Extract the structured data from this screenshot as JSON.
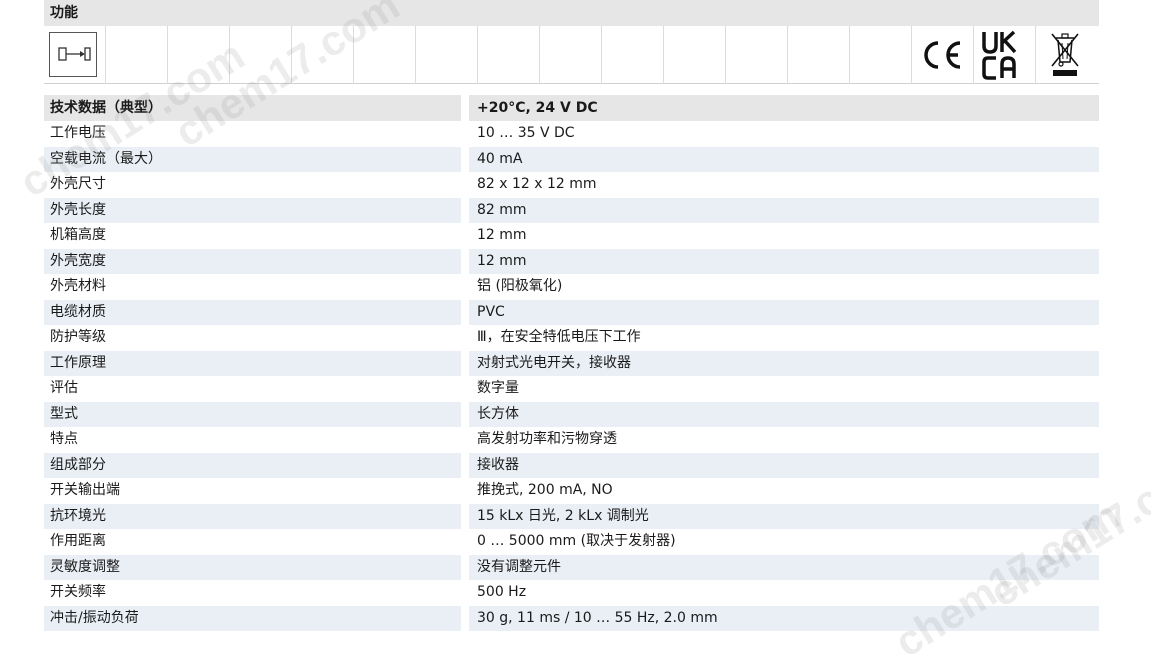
{
  "functions": {
    "title": "功能",
    "certifications": [
      "CE",
      "UK CA",
      "WEEE"
    ]
  },
  "tech": {
    "header_label": "技术数据（典型）",
    "header_condition": "+20°C, 24 V DC",
    "rows": [
      {
        "label": "工作电压",
        "value": "10 … 35 V DC"
      },
      {
        "label": "空载电流（最大）",
        "value": "40 mA"
      },
      {
        "label": "外壳尺寸",
        "value": "82 x 12 x 12 mm"
      },
      {
        "label": "外壳长度",
        "value": "82 mm"
      },
      {
        "label": "机箱高度",
        "value": "12 mm"
      },
      {
        "label": "外壳宽度",
        "value": "12 mm"
      },
      {
        "label": "外壳材料",
        "value": "铝 (阳极氧化)"
      },
      {
        "label": "电缆材质",
        "value": "PVC"
      },
      {
        "label": "防护等级",
        "value": "Ⅲ，在安全特低电压下工作"
      },
      {
        "label": "工作原理",
        "value": "对射式光电开关，接收器"
      },
      {
        "label": "评估",
        "value": "数字量"
      },
      {
        "label": "型式",
        "value": "长方体"
      },
      {
        "label": "特点",
        "value": "高发射功率和污物穿透"
      },
      {
        "label": "组成部分",
        "value": "接收器"
      },
      {
        "label": "开关输出端",
        "value": "推挽式, 200 mA, NO"
      },
      {
        "label": "抗环境光",
        "value": "15 kLx 日光, 2 kLx 调制光"
      },
      {
        "label": "作用距离",
        "value": "0 … 5000 mm (取决于发射器)"
      },
      {
        "label": "灵敏度调整",
        "value": "没有调整元件"
      },
      {
        "label": "开关频率",
        "value": "500 Hz"
      },
      {
        "label": "冲击/振动负荷",
        "value": "30 g, 11 ms / 10 … 55 Hz, 2.0 mm"
      }
    ]
  },
  "watermark": "chem17.com"
}
